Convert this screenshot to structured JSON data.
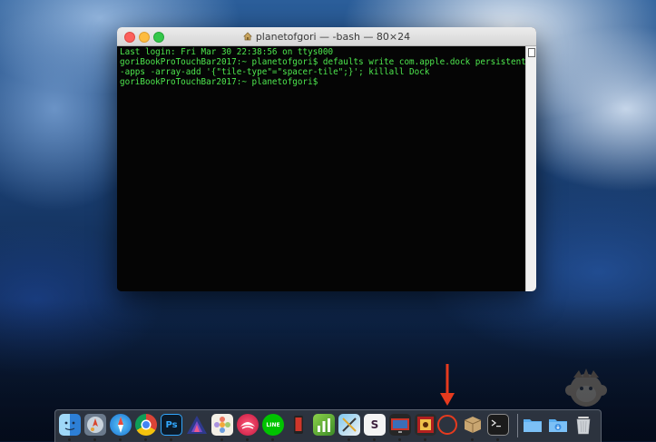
{
  "terminal": {
    "title": "planetofgori — -bash — 80×24",
    "lines": [
      "Last login: Fri Mar 30 22:38:56 on ttys000",
      "goriBookProTouchBar2017:~ planetofgori$ defaults write com.apple.dock persistent",
      "-apps -array-add '{\"tile-type\"=\"spacer-tile\";}'; killall Dock",
      "goriBookProTouchBar2017:~ planetofgori$ "
    ]
  },
  "dock": {
    "apps": [
      {
        "icon": "finder-icon"
      },
      {
        "icon": "launchpad-icon"
      },
      {
        "icon": "safari-icon"
      },
      {
        "icon": "chrome-icon"
      },
      {
        "icon": "photoshop-icon",
        "label": "Ps"
      },
      {
        "icon": "affinity-photo-icon"
      },
      {
        "icon": "photos-app-icon"
      },
      {
        "icon": "affinity-designer-icon"
      },
      {
        "icon": "line-icon",
        "label": "LINE"
      },
      {
        "icon": "mobile-app-icon"
      },
      {
        "icon": "numbers-icon"
      },
      {
        "icon": "pixelmator-icon"
      },
      {
        "icon": "slack-icon",
        "label": "S"
      },
      {
        "icon": "screen-icon"
      },
      {
        "icon": "photo-booth-icon"
      },
      {
        "icon": "spacer-tile"
      },
      {
        "icon": "package-icon"
      },
      {
        "icon": "terminal-icon"
      },
      {
        "icon": "applications-folder-icon"
      },
      {
        "icon": "downloads-folder-icon"
      },
      {
        "icon": "trash-icon"
      }
    ],
    "colors": {
      "highlight": "#e63a1e",
      "terminal_text": "#4ee84e"
    }
  }
}
